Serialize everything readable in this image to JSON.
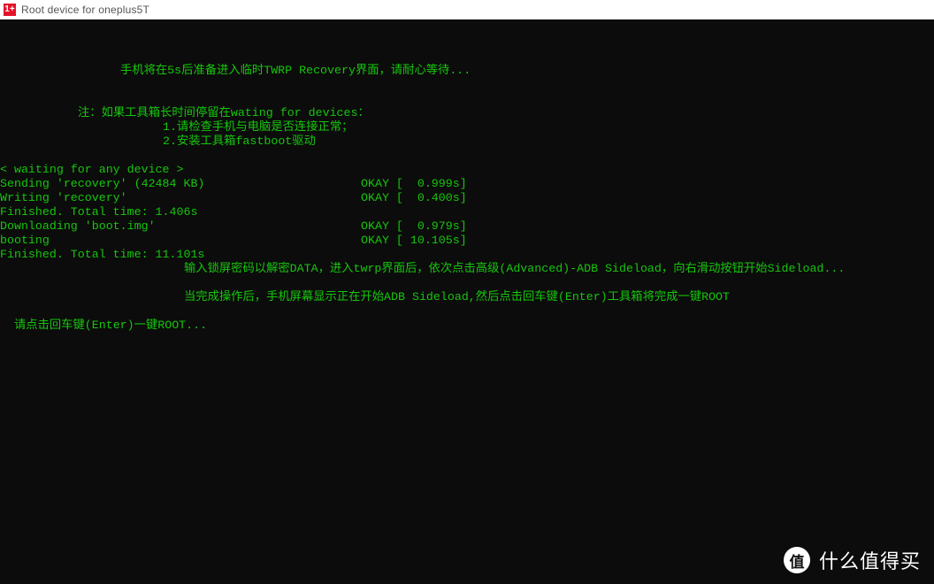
{
  "window": {
    "title": "Root device for oneplus5T",
    "icon_glyph": "1+",
    "icon_name": "oneplus-logo-icon",
    "colors": {
      "titlebar_bg": "#ffffff",
      "console_bg": "#0c0c0c",
      "console_text": "#16c60c",
      "icon_red": "#e4132a"
    }
  },
  "console": {
    "lines": [
      "手机将在5s后准备进入临时TWRP Recovery界面，请耐心等待...",
      "注：如果工具箱长时间停留在wating for devices：",
      "1.请检查手机与电脑是否连接正常；",
      "2.安装工具箱fastboot驱动",
      "< waiting for any device >",
      "Sending 'recovery' (42484 KB)",
      "OKAY [  0.999s]",
      "Writing 'recovery'",
      "OKAY [  0.400s]",
      "Finished. Total time: 1.406s",
      "Downloading 'boot.img'",
      "OKAY [  0.979s]",
      "booting",
      "OKAY [ 10.105s]",
      "Finished. Total time: 11.101s",
      "输入锁屏密码以解密DATA，进入twrp界面后，依次点击高级(Advanced)-ADB Sideload，向右滑动按钮开始Sideload...",
      "当完成操作后，手机屏幕显示正在开始ADB Sideload,然后点击回车键(Enter)工具箱将完成一键ROOT",
      "请点击回车键(Enter)一键ROOT..."
    ]
  },
  "watermark": {
    "badge_glyph": "值",
    "text": "什么值得买"
  }
}
